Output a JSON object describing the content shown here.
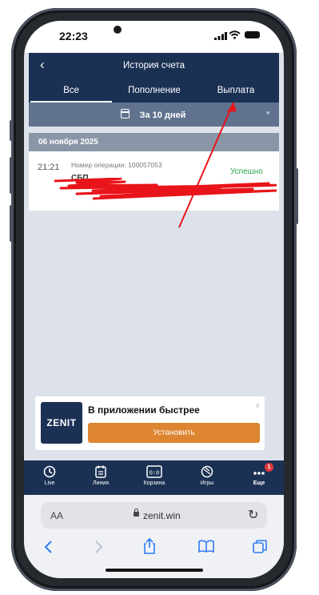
{
  "status": {
    "time": "22:23"
  },
  "header": {
    "back_glyph": "‹",
    "title": "История счета",
    "tabs": [
      {
        "label": "Все",
        "active": true
      },
      {
        "label": "Пополнение",
        "active": false
      },
      {
        "label": "Выплата",
        "active": false
      }
    ]
  },
  "filter": {
    "label": "За 10 дней",
    "icon": "calendar-icon"
  },
  "history": {
    "date": "06 ноября 2025",
    "operation": {
      "time": "21:21",
      "number_label": "Номер операции: 100057053",
      "status": "Успешно",
      "method": "СБП"
    }
  },
  "banner": {
    "logo": "ZENIT",
    "title": "В приложении быстрее",
    "close": "x",
    "button": "Установить"
  },
  "bottom_nav": {
    "items": [
      {
        "label": "Live",
        "icon": "clock-icon"
      },
      {
        "label": "Линия",
        "icon": "calendar-list-icon"
      },
      {
        "label": "Корзина",
        "icon": "coupon-icon"
      },
      {
        "label": "Игры",
        "icon": "dice-icon"
      },
      {
        "label": "Еще",
        "icon": "more-icon"
      }
    ],
    "badge": "1"
  },
  "browser": {
    "aa": "AA",
    "url": "zenit.win"
  },
  "colors": {
    "header": "#1b3154",
    "filter": "#60728d",
    "status_success": "#2aa54a",
    "install_button": "#dd8530",
    "badge": "#e3373f",
    "annotation": "#e8141a"
  }
}
